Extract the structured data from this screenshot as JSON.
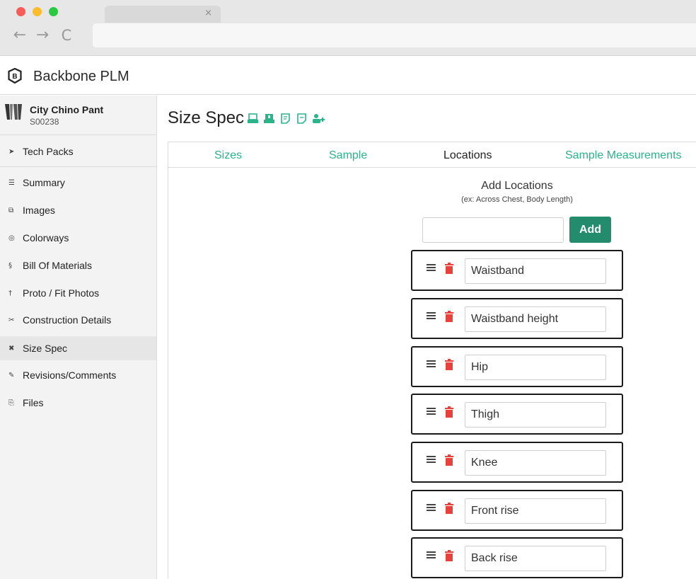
{
  "browser": {
    "tab_close": "×",
    "back": "←",
    "forward": "→",
    "reload": "C"
  },
  "app": {
    "title": "Backbone PLM"
  },
  "product": {
    "name": "City Chino Pant",
    "code": "S00238"
  },
  "sidebar": {
    "techpacks": {
      "label": "Tech Packs",
      "icon": "paper-plane-icon"
    },
    "items": [
      {
        "label": "Summary",
        "icon": "list-icon",
        "glyph": "☰"
      },
      {
        "label": "Images",
        "icon": "images-icon",
        "glyph": "⧉"
      },
      {
        "label": "Colorways",
        "icon": "palette-icon",
        "glyph": "◎"
      },
      {
        "label": "Bill Of Materials",
        "icon": "materials-icon",
        "glyph": "§"
      },
      {
        "label": "Proto / Fit Photos",
        "icon": "person-icon",
        "glyph": "†"
      },
      {
        "label": "Construction Details",
        "icon": "scissors-icon",
        "glyph": "✂"
      },
      {
        "label": "Size Spec",
        "icon": "tools-icon",
        "glyph": "✖"
      },
      {
        "label": "Revisions/Comments",
        "icon": "edit-icon",
        "glyph": "✎"
      },
      {
        "label": "Files",
        "icon": "files-icon",
        "glyph": "⎘"
      }
    ],
    "active": "Size Spec"
  },
  "main": {
    "title": "Size Spec",
    "tabs": [
      "Sizes",
      "Sample",
      "Locations",
      "Sample Measurements"
    ],
    "active_tab": "Locations",
    "add_title": "Add Locations",
    "add_hint": "(ex: Across Chest, Body Length)",
    "add_input_value": "",
    "add_button": "Add",
    "locations": [
      "Waistband",
      "Waistband height",
      "Hip",
      "Thigh",
      "Knee",
      "Front rise",
      "Back rise"
    ]
  },
  "colors": {
    "accent": "#2bb38a",
    "button": "#238c6c",
    "delete": "#e8403a"
  }
}
